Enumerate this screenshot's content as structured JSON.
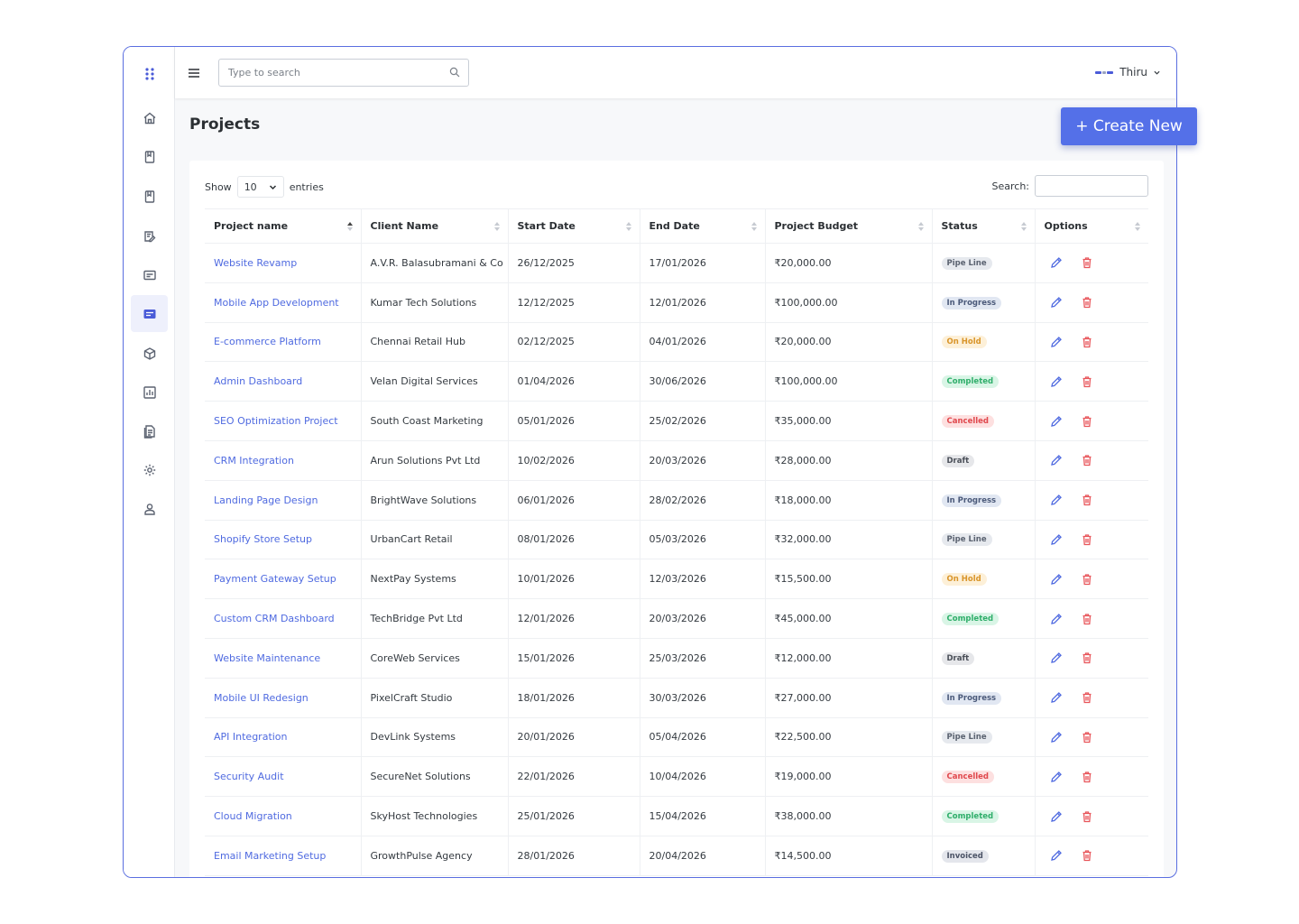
{
  "search": {
    "placeholder": "Type to search"
  },
  "user": {
    "name": "Thiru"
  },
  "page": {
    "title": "Projects",
    "create_label": "+ Create New"
  },
  "table_controls": {
    "show_label": "Show",
    "entries_value": "10",
    "entries_label": "entries",
    "search_label": "Search:"
  },
  "columns": [
    "Project name",
    "Client Name",
    "Start Date",
    "End Date",
    "Project Budget",
    "Status",
    "Options"
  ],
  "rows": [
    {
      "project": "Website Revamp",
      "client": "A.V.R. Balasubramani & Co",
      "start": "26/12/2025",
      "end": "17/01/2026",
      "budget": "₹20,000.00",
      "status": "Pipe Line"
    },
    {
      "project": "Mobile App Development",
      "client": "Kumar Tech Solutions",
      "start": "12/12/2025",
      "end": "12/01/2026",
      "budget": "₹100,000.00",
      "status": "In Progress"
    },
    {
      "project": "E-commerce Platform",
      "client": "Chennai Retail Hub",
      "start": "02/12/2025",
      "end": "04/01/2026",
      "budget": "₹20,000.00",
      "status": "On Hold"
    },
    {
      "project": "Admin Dashboard",
      "client": "Velan Digital Services",
      "start": "01/04/2026",
      "end": "30/06/2026",
      "budget": "₹100,000.00",
      "status": "Completed"
    },
    {
      "project": "SEO Optimization Project",
      "client": "South Coast Marketing",
      "start": "05/01/2026",
      "end": "25/02/2026",
      "budget": "₹35,000.00",
      "status": "Cancelled"
    },
    {
      "project": "CRM Integration",
      "client": "Arun Solutions Pvt Ltd",
      "start": "10/02/2026",
      "end": "20/03/2026",
      "budget": "₹28,000.00",
      "status": "Draft"
    },
    {
      "project": "Landing Page Design",
      "client": "BrightWave Solutions",
      "start": "06/01/2026",
      "end": "28/02/2026",
      "budget": "₹18,000.00",
      "status": "In Progress"
    },
    {
      "project": "Shopify Store Setup",
      "client": "UrbanCart Retail",
      "start": "08/01/2026",
      "end": "05/03/2026",
      "budget": "₹32,000.00",
      "status": "Pipe Line"
    },
    {
      "project": "Payment Gateway Setup",
      "client": "NextPay Systems",
      "start": "10/01/2026",
      "end": "12/03/2026",
      "budget": "₹15,500.00",
      "status": "On Hold"
    },
    {
      "project": "Custom CRM Dashboard",
      "client": "TechBridge Pvt Ltd",
      "start": "12/01/2026",
      "end": "20/03/2026",
      "budget": "₹45,000.00",
      "status": "Completed"
    },
    {
      "project": "Website Maintenance",
      "client": "CoreWeb Services",
      "start": "15/01/2026",
      "end": "25/03/2026",
      "budget": "₹12,000.00",
      "status": "Draft"
    },
    {
      "project": "Mobile UI Redesign",
      "client": "PixelCraft Studio",
      "start": "18/01/2026",
      "end": "30/03/2026",
      "budget": "₹27,000.00",
      "status": "In Progress"
    },
    {
      "project": "API Integration",
      "client": "DevLink Systems",
      "start": "20/01/2026",
      "end": "05/04/2026",
      "budget": "₹22,500.00",
      "status": "Pipe Line"
    },
    {
      "project": "Security Audit",
      "client": "SecureNet Solutions",
      "start": "22/01/2026",
      "end": "10/04/2026",
      "budget": "₹19,000.00",
      "status": "Cancelled"
    },
    {
      "project": "Cloud Migration",
      "client": "SkyHost Technologies",
      "start": "25/01/2026",
      "end": "15/04/2026",
      "budget": "₹38,000.00",
      "status": "Completed"
    },
    {
      "project": "Email Marketing Setup",
      "client": "GrowthPulse Agency",
      "start": "28/01/2026",
      "end": "20/04/2026",
      "budget": "₹14,500.00",
      "status": "Invoiced"
    }
  ],
  "status_colors": {
    "Pipe Line": {
      "bg": "#e6e9ee",
      "fg": "#5a6270"
    },
    "In Progress": {
      "bg": "#e1e7f2",
      "fg": "#4b5a7a"
    },
    "On Hold": {
      "bg": "#fdf0d8",
      "fg": "#d9952a"
    },
    "Completed": {
      "bg": "#d9f5e6",
      "fg": "#2fae6a"
    },
    "Cancelled": {
      "bg": "#fde0e0",
      "fg": "#e0484d"
    },
    "Draft": {
      "bg": "#e6e7ea",
      "fg": "#4a4f58"
    },
    "Invoiced": {
      "bg": "#e4e6ec",
      "fg": "#4b5366"
    }
  },
  "colors": {
    "accent": "#5470e8",
    "link": "#4f6ae0",
    "delete": "#e8555a",
    "frame": "#5a6ee0"
  },
  "sidebar": {
    "items": [
      {
        "icon": "dots-logo-icon"
      },
      {
        "icon": "home-icon"
      },
      {
        "icon": "bookmark-icon"
      },
      {
        "icon": "bookmark-icon"
      },
      {
        "icon": "edit-note-icon"
      },
      {
        "icon": "card-icon"
      },
      {
        "icon": "list-card-icon",
        "active": true
      },
      {
        "icon": "box-icon"
      },
      {
        "icon": "chart-icon"
      },
      {
        "icon": "document-icon"
      },
      {
        "icon": "gear-icon"
      },
      {
        "icon": "user-icon"
      }
    ]
  }
}
